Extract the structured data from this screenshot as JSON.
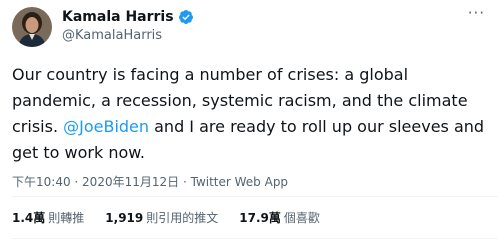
{
  "author": {
    "name": "Kamala Harris",
    "handle": "@KamalaHarris",
    "verified": true,
    "avatar": "avatar"
  },
  "more_icon": "ellipsis-icon",
  "tweet": {
    "text_before": "Our country is facing a number of crises: a global pandemic, a recession, systemic racism, and the climate crisis. ",
    "mention": "@JoeBiden",
    "text_after": " and I are ready to roll up our sleeves and get to work now."
  },
  "meta": {
    "time": "下午10:40",
    "sep1": " · ",
    "date": "2020年11月12日",
    "sep2": " · ",
    "source": "Twitter Web App"
  },
  "stats": [
    {
      "num": "1.4萬",
      "label": "則轉推"
    },
    {
      "num": "1,919",
      "label": "則引用的推文"
    },
    {
      "num": "17.9萬",
      "label": "個喜歡"
    }
  ],
  "colors": {
    "accent": "#1d9bf0",
    "secondary_text": "#536471",
    "divider": "#eff3f4"
  }
}
